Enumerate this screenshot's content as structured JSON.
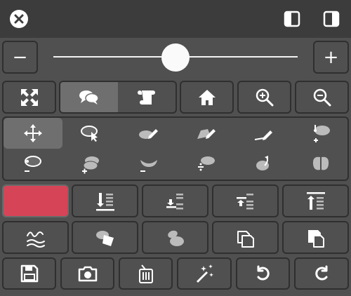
{
  "zoom": {
    "minus_label": "−",
    "plus_label": "+",
    "level": 0.5
  },
  "icons": {
    "close": "close-icon",
    "panel_left": "panel-left-icon",
    "panel_right": "panel-right-icon",
    "fit": "fit-to-screen-icon",
    "comment": "comments-icon",
    "scroll": "scroll-icon",
    "home": "home-icon",
    "zoom_in": "zoom-in-icon",
    "zoom_out": "zoom-out-icon"
  },
  "colors": {
    "accent_red": "#d54557",
    "background": "#505050",
    "bar": "#3c3c3c"
  }
}
